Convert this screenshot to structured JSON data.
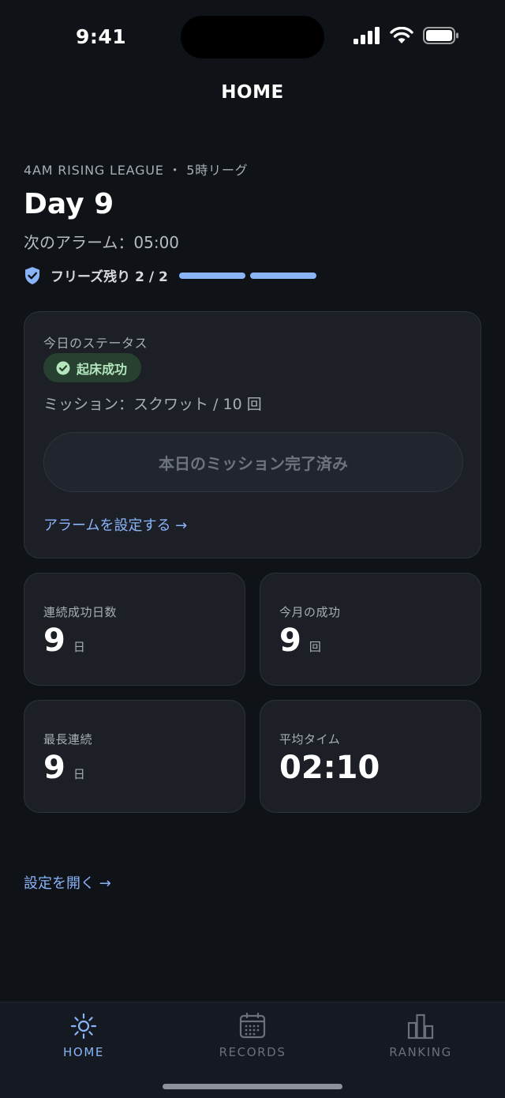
{
  "status_bar": {
    "time": "9:41"
  },
  "nav": {
    "title": "HOME"
  },
  "header": {
    "league": "4AM RISING LEAGUE ・ 5時リーグ",
    "day": "Day 9",
    "next_alarm": "次のアラーム：05:00",
    "freeze": "フリーズ残り 2 / 2",
    "freeze_remaining": 2,
    "freeze_total": 2
  },
  "status_card": {
    "label": "今日のステータス",
    "badge": "起床成功",
    "mission": "ミッション：スクワット / 10 回",
    "button": "本日のミッション完了済み",
    "alarm_link": "アラームを設定する →"
  },
  "stats": [
    {
      "label": "連続成功日数",
      "value": "9",
      "unit": "日"
    },
    {
      "label": "今月の成功",
      "value": "9",
      "unit": "回"
    },
    {
      "label": "最長連続",
      "value": "9",
      "unit": "日"
    },
    {
      "label": "平均タイム",
      "value": "02:10",
      "unit": ""
    }
  ],
  "settings_link": "設定を開く →",
  "tabs": [
    {
      "label": "HOME",
      "icon": "sun-icon",
      "active": true
    },
    {
      "label": "RECORDS",
      "icon": "calendar-icon",
      "active": false
    },
    {
      "label": "RANKING",
      "icon": "bar-chart-icon",
      "active": false
    }
  ],
  "colors": {
    "background": "#0f1217",
    "card": "#1c1f26",
    "accent": "#8ab4f8",
    "success_badge_bg": "#27402f",
    "success_badge_text": "#b3e6bd"
  }
}
